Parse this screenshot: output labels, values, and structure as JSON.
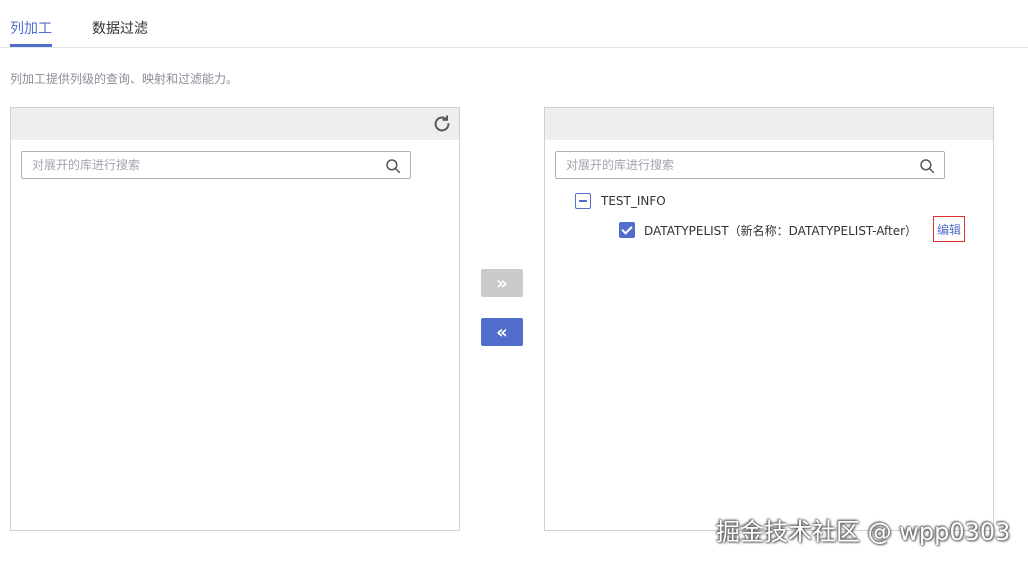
{
  "tabs": [
    {
      "label": "列加工",
      "active": true
    },
    {
      "label": "数据过滤",
      "active": false
    }
  ],
  "description": "列加工提供列级的查询、映射和过滤能力。",
  "left_panel": {
    "search_placeholder": "对展开的库进行搜索",
    "refresh_icon": "refresh-icon"
  },
  "right_panel": {
    "search_placeholder": "对展开的库进行搜索",
    "tree": {
      "database": "TEST_INFO",
      "table": "DATATYPELIST（新名称：DATATYPELIST-After）",
      "edit_label": "编辑"
    }
  },
  "transfer": {
    "right_icon": "»",
    "left_icon": "«"
  },
  "watermark": "掘金技术社区 @ wpp0303",
  "colors": {
    "accent": "#526ecc",
    "disabled": "#cbcbcb",
    "highlight_border": "#e03030"
  }
}
